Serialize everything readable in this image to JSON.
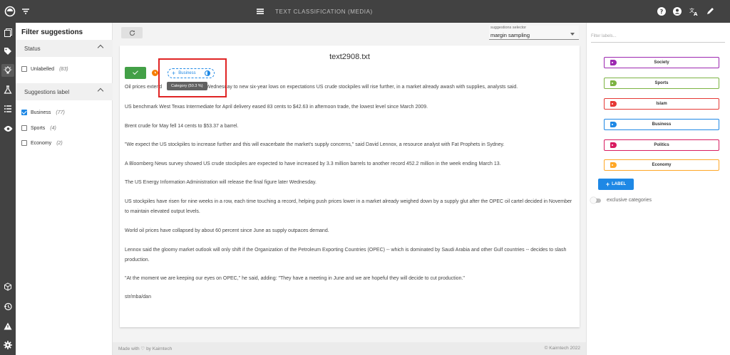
{
  "app": {
    "title": "TEXT CLASSIFICATION (MEDIA)"
  },
  "filter": {
    "heading": "Filter suggestions",
    "status_section": "Status",
    "status_items": [
      {
        "label": "Unlabelled",
        "count": "(83)",
        "checked": false
      }
    ],
    "labels_section": "Suggestions label",
    "label_items": [
      {
        "label": "Business",
        "count": "(77)",
        "checked": true
      },
      {
        "label": "Sports",
        "count": "(4)",
        "checked": false
      },
      {
        "label": "Economy",
        "count": "(2)",
        "checked": false
      }
    ]
  },
  "selector": {
    "label": "suggestions selector",
    "value": "margin sampling"
  },
  "document": {
    "title": "text2908.txt",
    "chip_label": "Business",
    "tooltip": "Category (50.3 %)",
    "first_line_start": "Oil prices extend",
    "first_line_rest": "a Wednesday to new six-year lows on expectations US crude stockpiles will rise further, in a market already awash with supplies, analysts said.",
    "paragraphs": [
      "US benchmark West Texas Intermediate for April delivery eased 83 cents to $42.63 in afternoon trade, the lowest level since March 2009.",
      "Brent crude for May fell 14 cents to $53.37 a barrel.",
      "\"We expect the US stockpiles to increase further and this will exacerbate the market's supply concerns,\" said David Lennox, a resource analyst with Fat Prophets in Sydney.",
      "A Bloomberg News survey showed US crude stockpiles are expected to have increased by 3.3 million barrels to another record 452.2 million in the week ending March 13.",
      "The US Energy Information Administration will release the final figure later Wednesday.",
      "US stockpiles have risen for nine weeks in a row, each time touching a record, helping push prices lower in a market already weighed down by a supply glut after the OPEC oil cartel decided in November to maintain elevated output levels.",
      "World oil prices have collapsed by about 60 percent since June as supply outpaces demand.",
      "Lennox said the gloomy market outlook will only shift if the Organization of the Petroleum Exporting Countries (OPEC) -- which is dominated by Saudi Arabia and other Gulf countries -- decides to slash production.",
      "\"At the moment we are keeping our eyes on OPEC,\" he said, adding: \"They have a meeting in June and we are hopeful they will decide to cut production.\"",
      "str/mba/dan"
    ]
  },
  "footer": {
    "left": "Made with ♡ by Kairntech",
    "right": "©   Kairntech 2022"
  },
  "label_panel": {
    "search_placeholder": "Filter labels...",
    "labels": [
      {
        "name": "Society",
        "color": "#9c27b0"
      },
      {
        "name": "Sports",
        "color": "#7cb342"
      },
      {
        "name": "Islam",
        "color": "#e53935"
      },
      {
        "name": "Business",
        "color": "#1e88e5"
      },
      {
        "name": "Politics",
        "color": "#d81b60"
      },
      {
        "name": "Economy",
        "color": "#ffa726"
      }
    ],
    "add_label": "LABEL",
    "exclusive_label": "exclusive categories"
  }
}
